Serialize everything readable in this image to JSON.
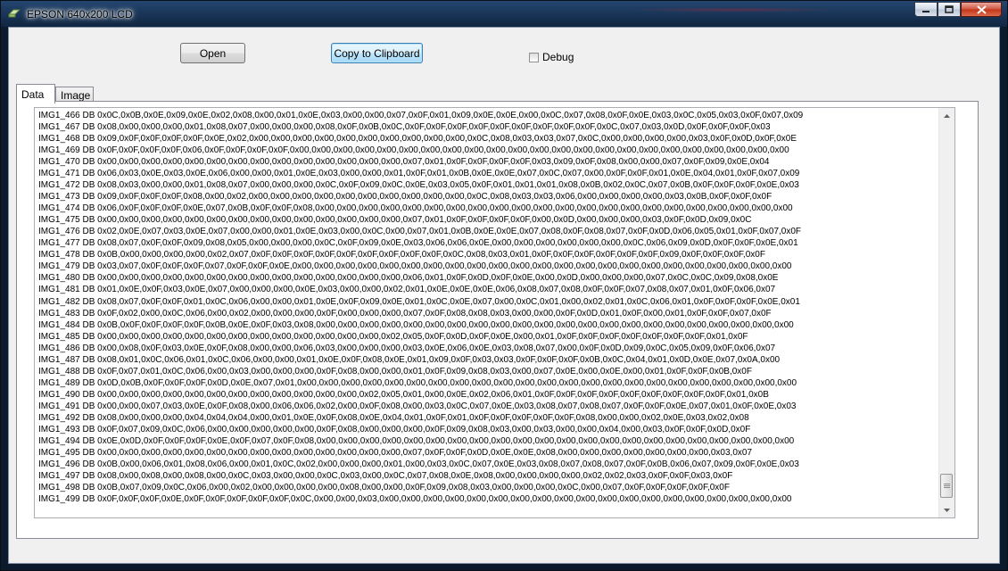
{
  "window": {
    "title": "EPSON 640x200 LCD"
  },
  "toolbar": {
    "open_label": "Open",
    "copy_label": "Copy to Clipboard",
    "debug_label": "Debug",
    "debug_checked": false
  },
  "tabs": [
    {
      "label": "Data",
      "active": true
    },
    {
      "label": "Image",
      "active": false
    }
  ],
  "data_lines": [
    "IMG1_466 DB 0x0C,0x0B,0x0E,0x09,0x0E,0x02,0x08,0x00,0x01,0x0E,0x03,0x00,0x00,0x07,0x0F,0x01,0x09,0x0E,0x0E,0x00,0x0C,0x07,0x08,0x0F,0x0E,0x03,0x0C,0x05,0x03,0x0F,0x07,0x09",
    "IMG1_467 DB 0x08,0x00,0x00,0x00,0x01,0x08,0x07,0x00,0x00,0x00,0x08,0x0F,0x0B,0x0C,0x0F,0x0F,0x0F,0x0F,0x0F,0x0F,0x0F,0x0F,0x0F,0x0C,0x07,0x03,0x0D,0x0F,0x0F,0x0F,0x03",
    "IMG1_468 DB 0x09,0x0F,0x0F,0x0F,0x0F,0x0E,0x02,0x00,0x00,0x00,0x00,0x00,0x00,0x00,0x00,0x00,0x00,0x0C,0x08,0x03,0x03,0x07,0x0C,0x00,0x00,0x00,0x00,0x03,0x0F,0x0D,0x0F,0x0E",
    "IMG1_469 DB 0x0F,0x0F,0x0F,0x0F,0x06,0x0F,0x0F,0x0F,0x0F,0x00,0x00,0x00,0x00,0x00,0x00,0x00,0x00,0x00,0x00,0x00,0x00,0x00,0x00,0x00,0x00,0x00,0x00,0x00,0x00,0x00,0x00,0x00",
    "IMG1_470 DB 0x00,0x00,0x00,0x00,0x00,0x00,0x00,0x00,0x00,0x00,0x00,0x00,0x00,0x00,0x07,0x01,0x0F,0x0F,0x0F,0x0F,0x03,0x09,0x0F,0x08,0x00,0x00,0x07,0x0F,0x09,0x0E,0x04",
    "IMG1_471 DB 0x06,0x03,0x0E,0x03,0x0E,0x06,0x00,0x00,0x01,0x0E,0x03,0x00,0x00,0x01,0x0F,0x01,0x0B,0x0E,0x0E,0x07,0x0C,0x07,0x00,0x0F,0x0F,0x01,0x0E,0x04,0x01,0x0F,0x07,0x09",
    "IMG1_472 DB 0x08,0x03,0x00,0x00,0x01,0x08,0x07,0x00,0x00,0x00,0x0C,0x0F,0x09,0x0C,0x0E,0x03,0x05,0x0F,0x01,0x01,0x01,0x08,0x0B,0x02,0x0C,0x07,0x0B,0x0F,0x0F,0x0F,0x0E,0x03",
    "IMG1_473 DB 0x09,0x0F,0x0F,0x0F,0x08,0x00,0x02,0x00,0x00,0x00,0x00,0x00,0x00,0x00,0x00,0x00,0x00,0x0C,0x08,0x03,0x03,0x06,0x00,0x00,0x00,0x00,0x03,0x0B,0x0F,0x0F,0x0F",
    "IMG1_474 DB 0x06,0x0F,0x0F,0x0F,0x0E,0x07,0x0B,0x0F,0x0F,0x08,0x00,0x00,0x00,0x00,0x00,0x00,0x00,0x00,0x00,0x00,0x00,0x00,0x00,0x00,0x00,0x00,0x00,0x00,0x00,0x00,0x00,0x00",
    "IMG1_475 DB 0x00,0x00,0x00,0x00,0x00,0x00,0x00,0x00,0x00,0x00,0x00,0x00,0x00,0x00,0x07,0x01,0x0F,0x0F,0x0F,0x0F,0x00,0x0D,0x00,0x00,0x00,0x03,0x0F,0x0D,0x09,0x0C",
    "IMG1_476 DB 0x02,0x0E,0x07,0x03,0x0E,0x07,0x00,0x00,0x01,0x0E,0x03,0x00,0x0C,0x00,0x07,0x01,0x0B,0x0E,0x0E,0x07,0x08,0x0F,0x08,0x07,0x0F,0x0D,0x06,0x05,0x01,0x0F,0x07,0x0F",
    "IMG1_477 DB 0x08,0x07,0x0F,0x0F,0x09,0x08,0x05,0x00,0x00,0x00,0x0C,0x0F,0x09,0x0E,0x03,0x06,0x06,0x0E,0x00,0x00,0x00,0x00,0x00,0x00,0x0C,0x06,0x09,0x0D,0x0F,0x0F,0x0E,0x01",
    "IMG1_478 DB 0x0B,0x00,0x00,0x00,0x00,0x02,0x07,0x0F,0x0F,0x0F,0x0F,0x0F,0x0F,0x0F,0x0F,0x0F,0x0C,0x08,0x03,0x01,0x0F,0x0F,0x0F,0x0F,0x0F,0x0F,0x09,0x0F,0x0F,0x0F,0x0F",
    "IMG1_479 DB 0x03,0x07,0x0F,0x0F,0x0F,0x07,0x0F,0x0F,0x0E,0x00,0x00,0x00,0x00,0x00,0x00,0x00,0x00,0x00,0x00,0x00,0x00,0x00,0x00,0x00,0x00,0x00,0x00,0x00,0x00,0x00,0x00,0x00",
    "IMG1_480 DB 0x00,0x00,0x00,0x00,0x00,0x00,0x00,0x00,0x00,0x00,0x00,0x00,0x00,0x00,0x06,0x01,0x0F,0x0D,0x0F,0x0E,0x00,0x0D,0x00,0x00,0x00,0x07,0x0C,0x0C,0x09,0x08,0x0E",
    "IMG1_481 DB 0x01,0x0E,0x0F,0x03,0x0E,0x07,0x00,0x00,0x00,0x0E,0x03,0x00,0x00,0x02,0x01,0x0E,0x0E,0x0E,0x06,0x08,0x07,0x08,0x0F,0x0F,0x07,0x08,0x07,0x01,0x0F,0x06,0x07",
    "IMG1_482 DB 0x08,0x07,0x0F,0x0F,0x01,0x0C,0x06,0x00,0x00,0x01,0x0E,0x0F,0x09,0x0E,0x01,0x0C,0x0E,0x07,0x00,0x0C,0x01,0x00,0x02,0x01,0x0C,0x06,0x01,0x0F,0x0F,0x0F,0x0E,0x01",
    "IMG1_483 DB 0x0F,0x02,0x00,0x0C,0x06,0x00,0x02,0x00,0x00,0x00,0x0F,0x00,0x00,0x00,0x07,0x0F,0x08,0x08,0x03,0x00,0x00,0x0F,0x0D,0x01,0x0F,0x00,0x01,0x0F,0x0F,0x07,0x0F",
    "IMG1_484 DB 0x0B,0x0F,0x0F,0x0F,0x0F,0x0B,0x0E,0x0F,0x03,0x08,0x00,0x00,0x00,0x00,0x00,0x00,0x00,0x00,0x00,0x00,0x00,0x00,0x00,0x00,0x00,0x00,0x00,0x00,0x00,0x00,0x00,0x00",
    "IMG1_485 DB 0x00,0x00,0x00,0x00,0x00,0x00,0x00,0x00,0x00,0x00,0x00,0x00,0x00,0x02,0x05,0x0F,0x0D,0x0F,0x0E,0x00,0x01,0x0F,0x0F,0x0F,0x0F,0x0F,0x0F,0x0F,0x01,0x0F",
    "IMG1_486 DB 0x00,0x08,0x0F,0x03,0x0E,0x0F,0x08,0x00,0x00,0x06,0x03,0x00,0x00,0x00,0x03,0x0E,0x06,0x0E,0x03,0x08,0x07,0x00,0x0F,0x0D,0x09,0x0C,0x05,0x09,0x0F,0x06,0x07",
    "IMG1_487 DB 0x08,0x01,0x0C,0x06,0x01,0x0C,0x06,0x00,0x00,0x01,0x0E,0x0F,0x08,0x0E,0x01,0x09,0x0F,0x03,0x03,0x0F,0x0F,0x0F,0x0B,0x0C,0x04,0x01,0x0D,0x0E,0x07,0x0A,0x00",
    "IMG1_488 DB 0x0F,0x07,0x01,0x0C,0x06,0x00,0x03,0x00,0x00,0x00,0x0F,0x08,0x00,0x00,0x01,0x0F,0x09,0x08,0x03,0x00,0x07,0x0E,0x00,0x0E,0x00,0x01,0x0F,0x0F,0x0B,0x0F",
    "IMG1_489 DB 0x0D,0x0B,0x0F,0x0F,0x0F,0x0D,0x0E,0x07,0x01,0x00,0x00,0x00,0x00,0x00,0x00,0x00,0x00,0x00,0x00,0x00,0x00,0x00,0x00,0x00,0x00,0x00,0x00,0x00,0x00,0x00,0x00,0x00",
    "IMG1_490 DB 0x00,0x00,0x00,0x00,0x00,0x00,0x00,0x00,0x00,0x00,0x00,0x00,0x02,0x05,0x01,0x00,0x0E,0x02,0x06,0x01,0x0F,0x0F,0x0F,0x0F,0x0F,0x0F,0x0F,0x0F,0x0F,0x01,0x0B",
    "IMG1_491 DB 0x00,0x00,0x07,0x03,0x0E,0x0F,0x08,0x00,0x06,0x06,0x02,0x00,0x0F,0x08,0x00,0x03,0x0C,0x07,0x0E,0x03,0x08,0x07,0x08,0x07,0x0F,0x0F,0x0E,0x07,0x01,0x0F,0x0E,0x03",
    "IMG1_492 DB 0x08,0x00,0x00,0x00,0x04,0x04,0x04,0x00,0x01,0x0E,0x0F,0x08,0x0E,0x04,0x01,0x0F,0x01,0x0F,0x0F,0x0F,0x0F,0x0F,0x08,0x00,0x00,0x02,0x0E,0x03,0x02,0x08",
    "IMG1_493 DB 0x0F,0x07,0x09,0x0C,0x06,0x00,0x00,0x00,0x00,0x00,0x0F,0x08,0x00,0x00,0x00,0x0F,0x09,0x08,0x03,0x00,0x03,0x00,0x00,0x04,0x00,0x03,0x0F,0x0F,0x0D,0x0F",
    "IMG1_494 DB 0x0E,0x0D,0x0F,0x0F,0x0F,0x0E,0x0F,0x07,0x0F,0x08,0x00,0x00,0x00,0x00,0x00,0x00,0x00,0x00,0x00,0x00,0x00,0x00,0x00,0x00,0x00,0x00,0x00,0x00,0x00,0x00,0x00,0x00",
    "IMG1_495 DB 0x00,0x00,0x00,0x00,0x00,0x00,0x00,0x00,0x00,0x00,0x00,0x00,0x00,0x00,0x07,0x0F,0x0F,0x0D,0x0E,0x0E,0x08,0x00,0x00,0x00,0x00,0x00,0x00,0x00,0x03,0x07",
    "IMG1_496 DB 0x0B,0x00,0x06,0x01,0x08,0x06,0x00,0x01,0x0C,0x02,0x00,0x00,0x00,0x01,0x00,0x03,0x0C,0x07,0x0E,0x03,0x08,0x07,0x08,0x07,0x0F,0x0B,0x06,0x07,0x09,0x0F,0x0E,0x03",
    "IMG1_497 DB 0x08,0x00,0x08,0x00,0x08,0x00,0x0C,0x03,0x00,0x00,0x0C,0x03,0x00,0x0C,0x07,0x08,0x0E,0x08,0x00,0x00,0x00,0x00,0x02,0x02,0x03,0x0F,0x0F,0x03,0x0F",
    "IMG1_498 DB 0x0B,0x07,0x09,0x0C,0x06,0x00,0x02,0x00,0x00,0x00,0x00,0x08,0x00,0x00,0x0F,0x09,0x08,0x03,0x00,0x00,0x00,0x0C,0x00,0x07,0x0F,0x0F,0x0F,0x0F,0x0F",
    "IMG1_499 DB 0x0F,0x0F,0x0F,0x0E,0x0F,0x0F,0x0F,0x0F,0x0F,0x0C,0x00,0x00,0x03,0x00,0x00,0x00,0x00,0x00,0x00,0x00,0x00,0x00,0x00,0x00,0x00,0x00,0x00,0x00,0x00,0x00,0x00,0x00"
  ]
}
